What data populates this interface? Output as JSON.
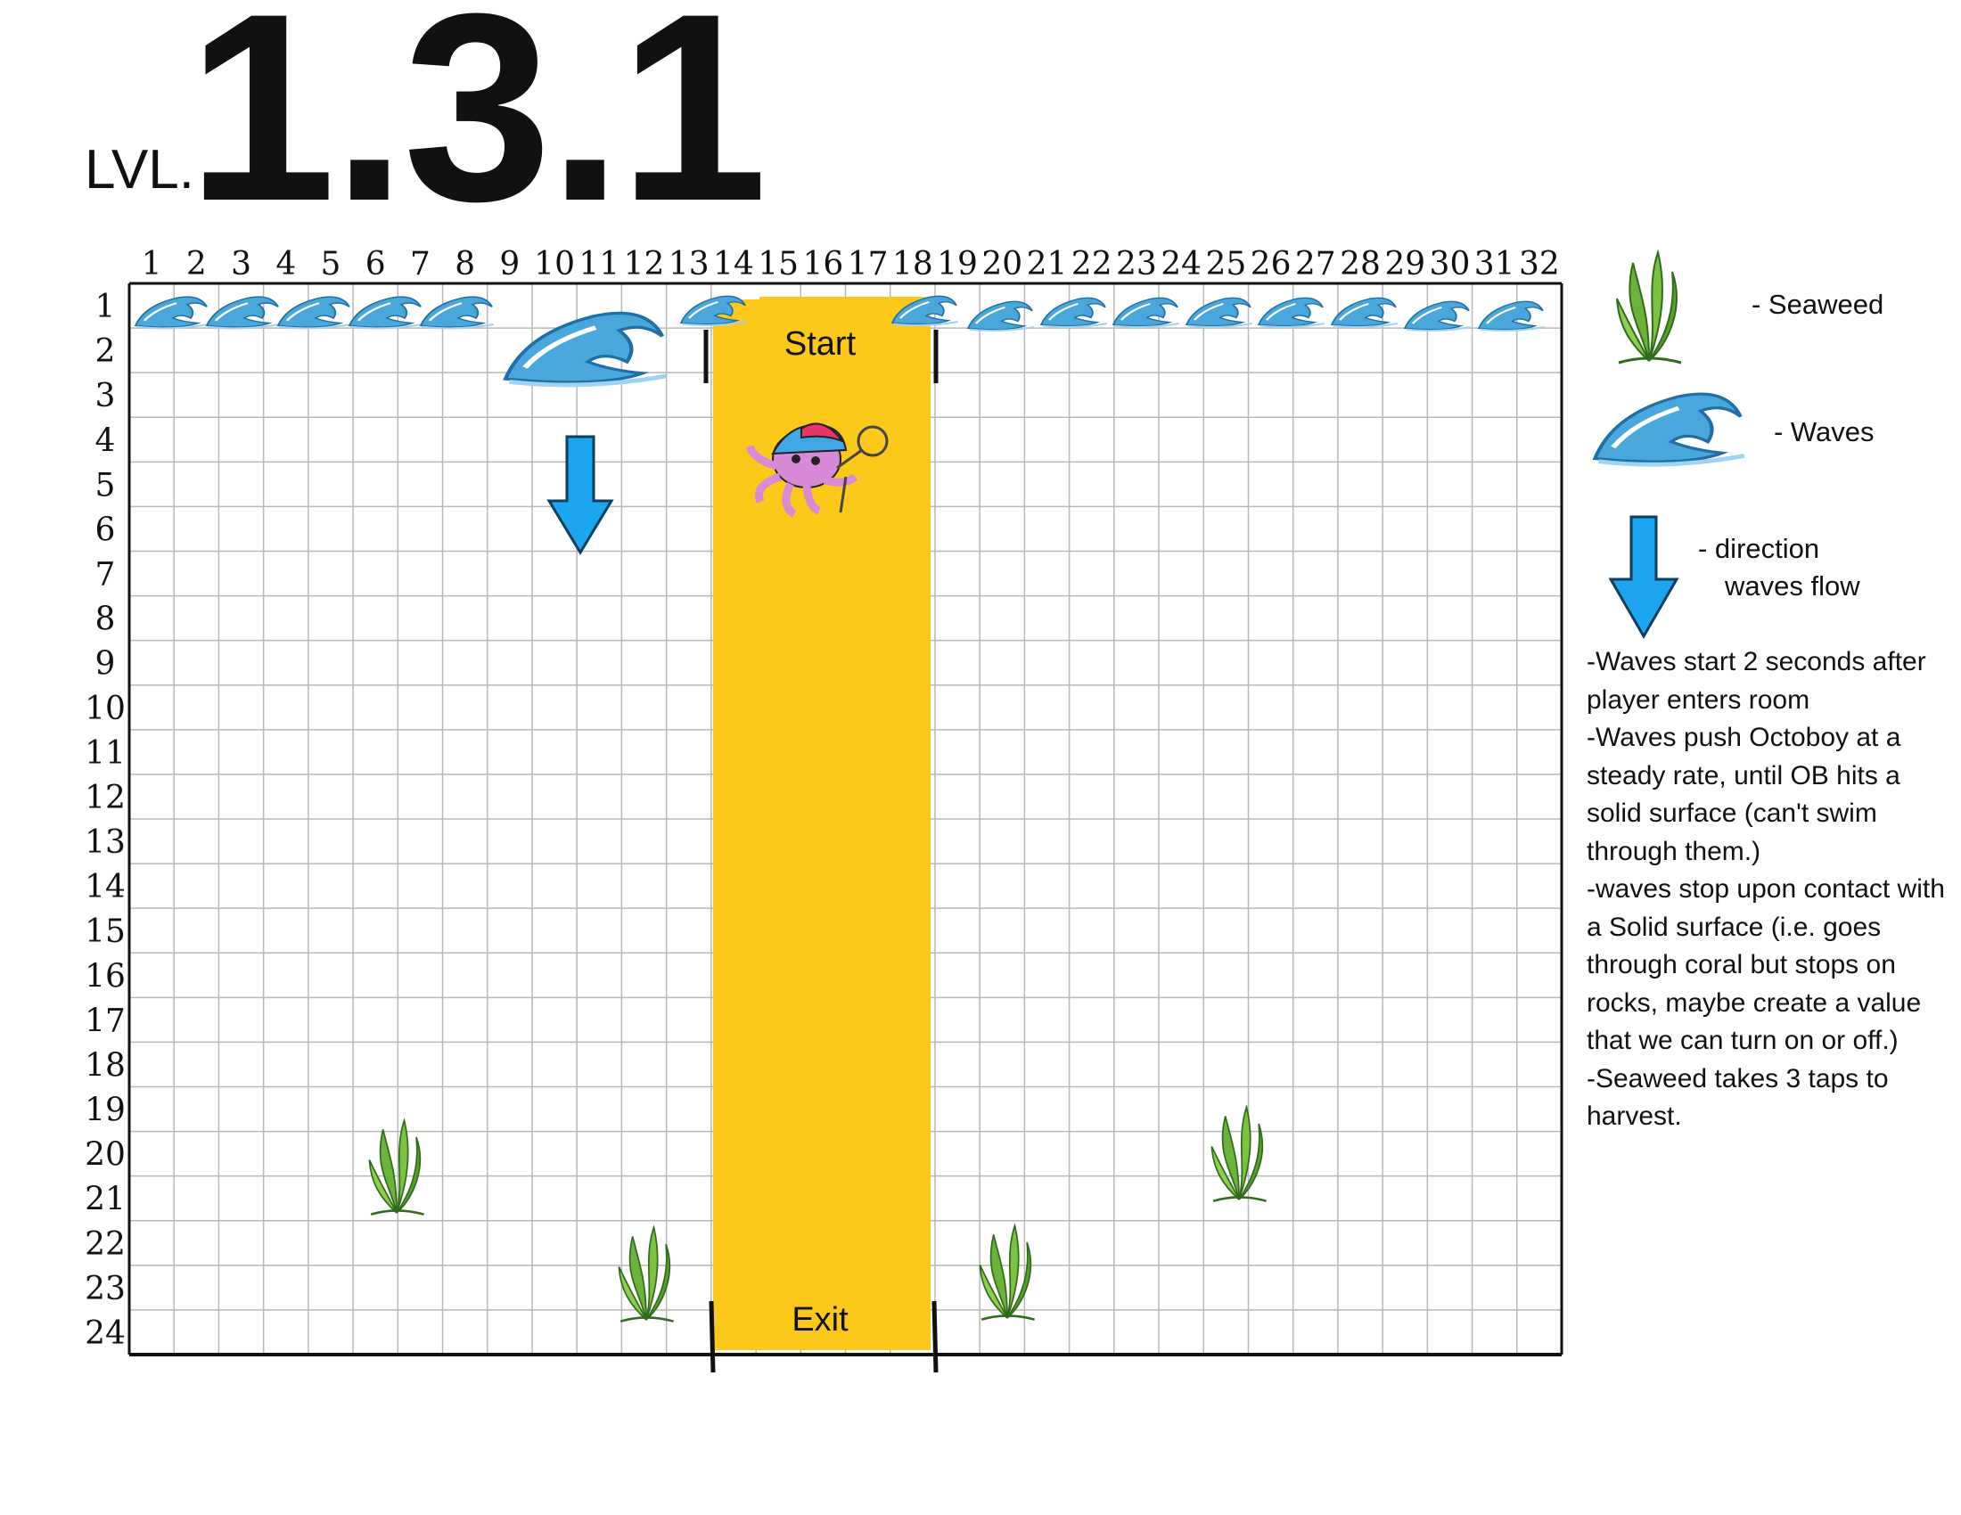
{
  "title": {
    "prefix": "LVL.",
    "number": "1.3.1"
  },
  "grid": {
    "columns": [
      "1",
      "2",
      "3",
      "4",
      "5",
      "6",
      "7",
      "8",
      "9",
      "10",
      "11",
      "12",
      "13",
      "14",
      "15",
      "16",
      "17",
      "18",
      "19",
      "20",
      "21",
      "22",
      "23",
      "24",
      "25",
      "26",
      "27",
      "28",
      "29",
      "30",
      "31",
      "32"
    ],
    "rows": [
      "1",
      "2",
      "3",
      "4",
      "5",
      "6",
      "7",
      "8",
      "9",
      "10",
      "11",
      "12",
      "13",
      "14",
      "15",
      "16",
      "17",
      "18",
      "19",
      "20",
      "21",
      "22",
      "23",
      "24"
    ]
  },
  "zone": {
    "start_label": "Start",
    "exit_label": "Exit",
    "color": "#fcc81a"
  },
  "legend": {
    "seaweed": "- Seaweed",
    "waves": "- Waves",
    "direction_line1": "-  direction",
    "direction_line2": "waves flow"
  },
  "notes": [
    "-Waves start 2 seconds after player enters room",
    "-Waves push Octoboy at a steady rate, until OB hits a solid surface (can't swim through them.)",
    "-waves stop upon contact with a Solid surface (i.e. goes through coral but stops on rocks, maybe create a value that we can turn on or off.)",
    "-Seaweed takes 3 taps to harvest."
  ],
  "colors": {
    "arrow": "#1ba6ef",
    "wave": "#4aa7dc",
    "seaweed": "#5fa633",
    "octopus": "#d98ad6"
  },
  "icons": [
    "wave-icon",
    "seaweed-icon",
    "down-arrow-icon",
    "octoboy-sprite"
  ]
}
